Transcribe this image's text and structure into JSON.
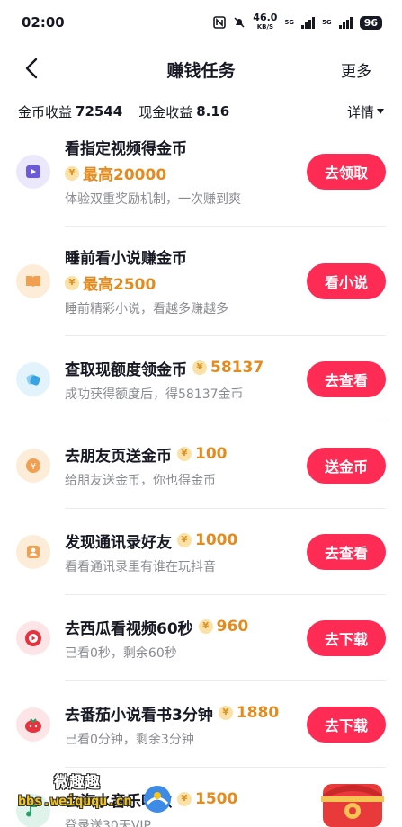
{
  "status_bar": {
    "time": "02:00",
    "net_speed": "46.0",
    "net_unit": "KB/S",
    "signal_label_1": "5G",
    "signal_label_2": "5G",
    "battery": "96"
  },
  "nav": {
    "title": "赚钱任务",
    "more": "更多"
  },
  "earnings": {
    "coin_label": "金币收益",
    "coin_value": "72544",
    "cash_label": "现金收益",
    "cash_value": "8.16",
    "details": "详情"
  },
  "coin_symbol": "¥",
  "tasks": [
    {
      "title": "看指定视频得金币",
      "reward": "最高20000",
      "desc": "体验双重奖励机制，一次赚到爽",
      "button": "去领取",
      "icon": "video-icon",
      "icon_bg": "#ece8fb",
      "icon_color": "#6b5bd6"
    },
    {
      "title": "睡前看小说赚金币",
      "reward": "最高2500",
      "desc": "睡前精彩小说，看越多赚越多",
      "button": "看小说",
      "icon": "book-icon",
      "icon_bg": "#fdecd8",
      "icon_color": "#f0a050"
    },
    {
      "title": "查取现额度领金币",
      "reward": "58137",
      "desc": "成功获得额度后，得58137金币",
      "button": "去查看",
      "icon": "quota-icon",
      "icon_bg": "#e3f3fb",
      "icon_color": "#3aa3e3"
    },
    {
      "title": "去朋友页送金币",
      "reward": "100",
      "desc": "给朋友送金币，你也得金币",
      "button": "送金币",
      "icon": "coin-gift-icon",
      "icon_bg": "#fdecd8",
      "icon_color": "#f0a050"
    },
    {
      "title": "发现通讯录好友",
      "reward": "1000",
      "desc": "看看通讯录里有谁在玩抖音",
      "button": "去查看",
      "icon": "contacts-icon",
      "icon_bg": "#fdecd8",
      "icon_color": "#f0a050"
    },
    {
      "title": "去西瓜看视频60秒",
      "reward": "960",
      "desc": "已看0秒，剩余60秒",
      "button": "去下载",
      "icon": "xigua-icon",
      "icon_bg": "#fde4e6",
      "icon_color": "#e8313c"
    },
    {
      "title": "去番茄小说看书3分钟",
      "reward": "1880",
      "desc": "已看0分钟，剩余3分钟",
      "button": "去下载",
      "icon": "tomato-icon",
      "icon_bg": "#fde4e6",
      "icon_color": "#e8313c"
    },
    {
      "title": "去汽水音乐听歌",
      "reward": "1500",
      "desc": "登录送30天VIP",
      "button": "",
      "icon": "music-icon",
      "icon_bg": "#dff3ea",
      "icon_color": "#2aa36b"
    }
  ],
  "watermark": {
    "name": "微趣趣",
    "url": "bbs.weiququ.cn"
  }
}
